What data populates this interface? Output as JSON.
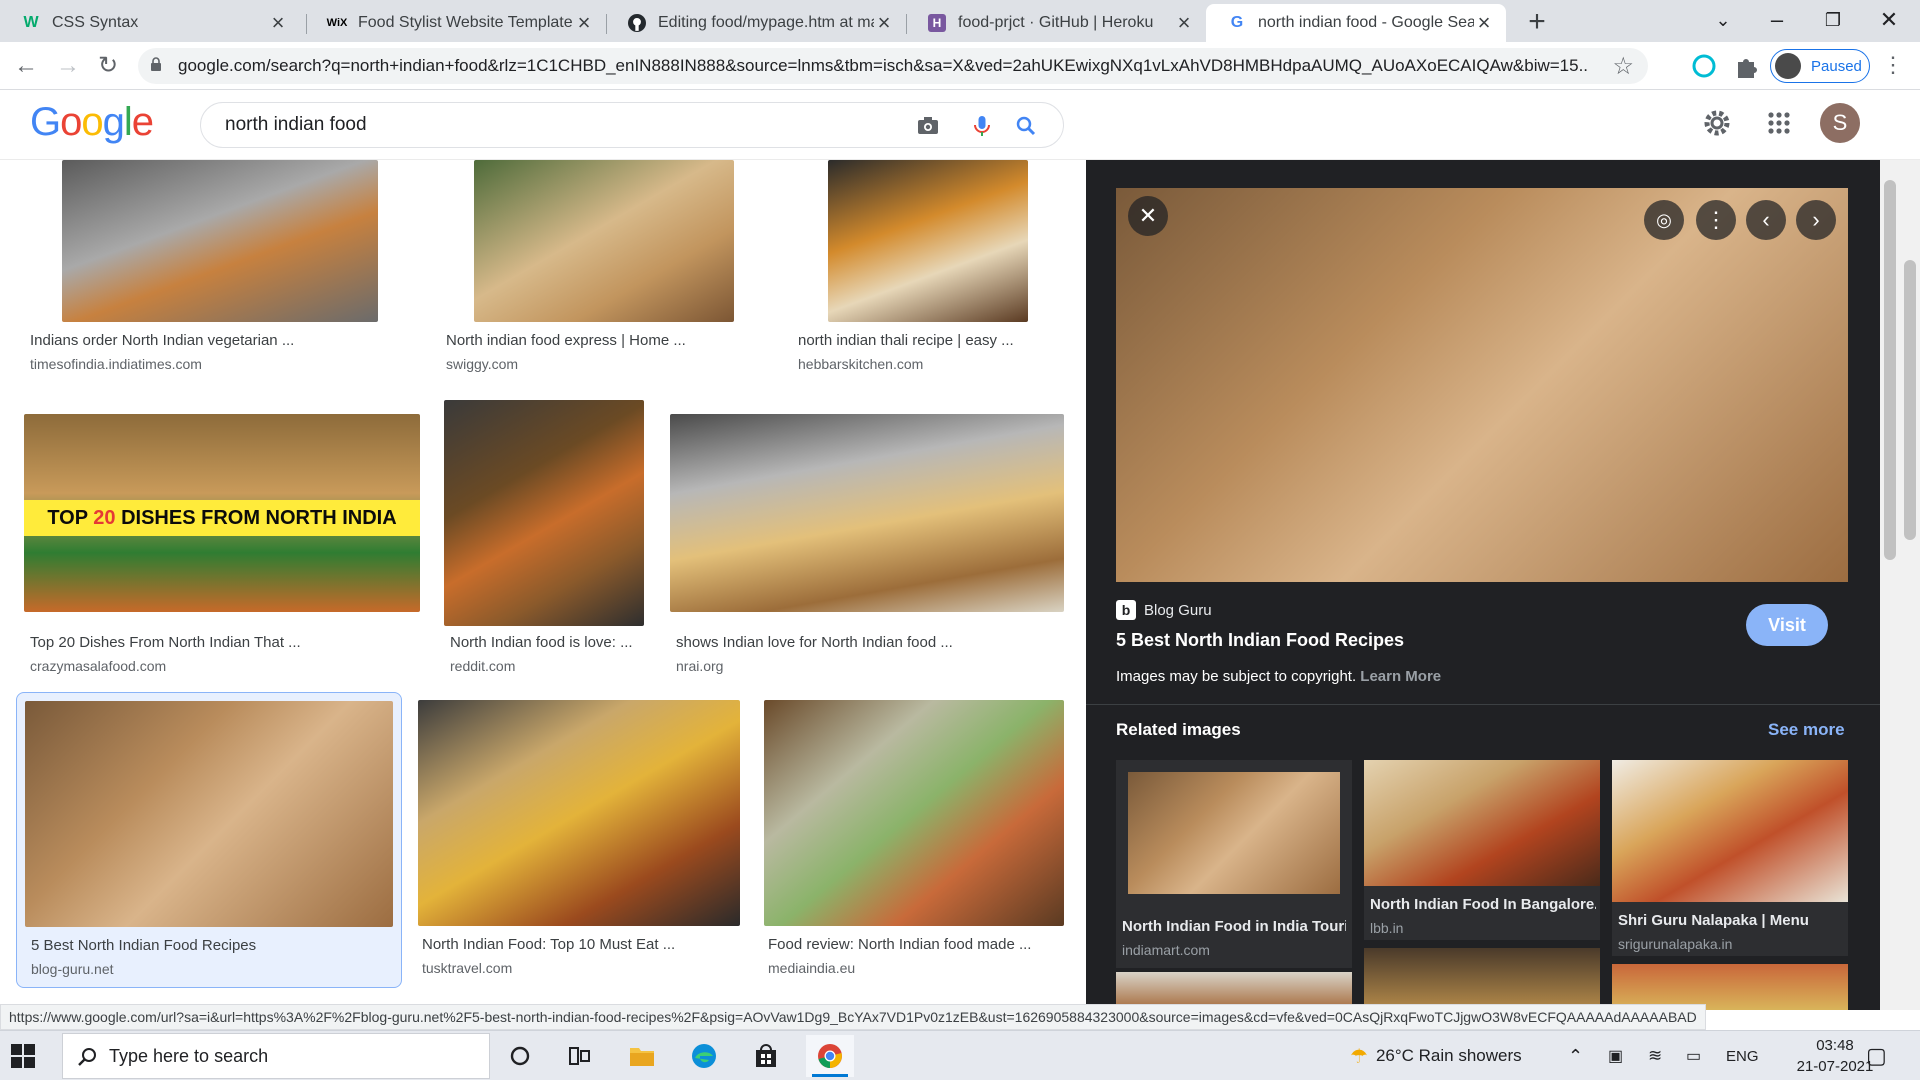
{
  "browser": {
    "tabs": [
      {
        "title": "CSS Syntax",
        "favicon": "w3schools-icon",
        "active": false
      },
      {
        "title": "Food Stylist Website Template | W",
        "favicon": "wix-icon",
        "active": false
      },
      {
        "title": "Editing food/mypage.htm at mas",
        "favicon": "github-icon",
        "active": false
      },
      {
        "title": "food-prjct · GitHub | Heroku",
        "favicon": "heroku-icon",
        "active": false
      },
      {
        "title": "north indian food - Google Searc",
        "favicon": "google-icon",
        "active": true
      }
    ],
    "url": "google.com/search?q=north+indian+food&rlz=1C1CHBD_enIN888IN888&source=lnms&tbm=isch&sa=X&ved=2ahUKEwixgNXq1vLxAhVD8HMBHdpaAUMQ_AUoAXoECAIQAw&biw=15...",
    "profile_status": "Paused"
  },
  "google": {
    "query": "north indian food",
    "avatar_letter": "S"
  },
  "results": [
    {
      "title": "Indians order North Indian vegetarian ...",
      "source": "timesofindia.indiatimes.com"
    },
    {
      "title": "North indian food express | Home ...",
      "source": "swiggy.com"
    },
    {
      "title": "north indian thali recipe | easy ...",
      "source": "hebbarskitchen.com"
    },
    {
      "title": "Top 20 Dishes From North Indian That ...",
      "source": "crazymasalafood.com",
      "banner_pre": "TOP ",
      "banner_num": "20",
      "banner_post": " DISHES FROM NORTH INDIA"
    },
    {
      "title": "North Indian food is love: ...",
      "source": "reddit.com"
    },
    {
      "title": "shows Indian love for North Indian food ...",
      "source": "nrai.org"
    },
    {
      "title": "5 Best North Indian Food Recipes",
      "source": "blog-guru.net"
    },
    {
      "title": "North Indian Food: Top 10 Must Eat ...",
      "source": "tusktravel.com"
    },
    {
      "title": "Food review: North Indian food made ...",
      "source": "mediaindia.eu"
    }
  ],
  "preview": {
    "source_name": "Blog Guru",
    "title": "5 Best North Indian Food Recipes",
    "visit_label": "Visit",
    "copyright": "Images may be subject to copyright.",
    "learn_more": "Learn More",
    "related_heading": "Related images",
    "see_more": "See more",
    "related": [
      {
        "title": "North Indian Food in India Touri...",
        "source": "indiamart.com"
      },
      {
        "title": "North Indian Food In Bangalore...",
        "source": "lbb.in"
      },
      {
        "title": "Shri Guru Nalapaka | Menu",
        "source": "srigurunalapaka.in"
      }
    ]
  },
  "status_url": "https://www.google.com/url?sa=i&url=https%3A%2F%2Fblog-guru.net%2F5-best-north-indian-food-recipes%2F&psig=AOvVaw1Dg9_BcYAx7VD1Pv0z1zEB&ust=1626905884323000&source=images&cd=vfe&ved=0CAsQjRxqFwoTCJjgwO3W8vECFQAAAAAdAAAAABAD",
  "taskbar": {
    "search_placeholder": "Type here to search",
    "weather": "26°C  Rain showers",
    "language": "ENG",
    "time": "03:48",
    "date": "21-07-2021"
  }
}
